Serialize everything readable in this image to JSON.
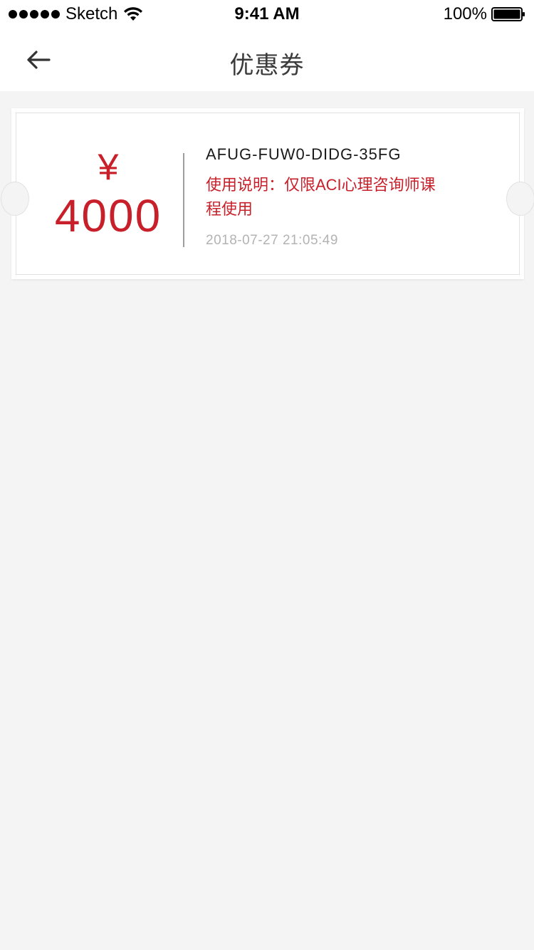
{
  "status_bar": {
    "carrier": "Sketch",
    "time": "9:41 AM",
    "battery": "100%"
  },
  "nav": {
    "title": "优惠券",
    "back_icon": "arrow-left-icon"
  },
  "coupon": {
    "currency_symbol": "¥",
    "amount": "4000",
    "code": "AFUG-FUW0-DIDG-35FG",
    "description": "使用说明：仅限ACI心理咨询师课程使用",
    "date": "2018-07-27 21:05:49"
  },
  "colors": {
    "accent": "#c8202a",
    "background": "#f4f4f4",
    "card": "#ffffff"
  }
}
